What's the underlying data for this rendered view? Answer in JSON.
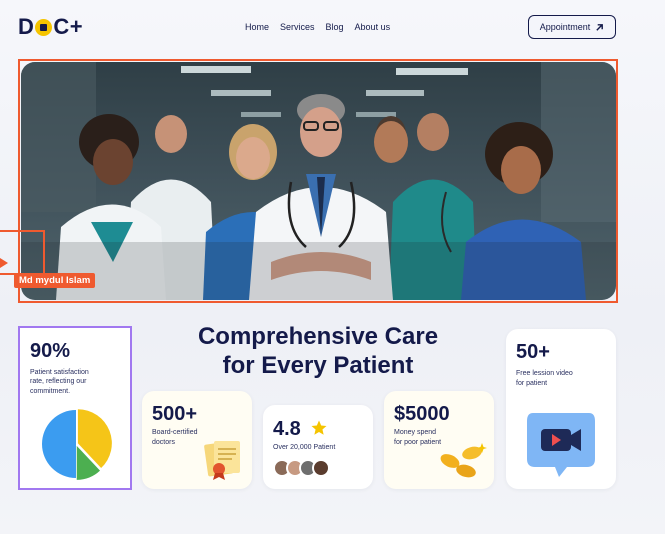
{
  "brand": {
    "logo_pre": "D",
    "logo_post": "C+"
  },
  "nav": {
    "items": [
      "Home",
      "Services",
      "Blog",
      "About us"
    ]
  },
  "header": {
    "appointment_label": "Appointment",
    "appointment_icon": "arrow-up-right-icon"
  },
  "hero": {
    "photo": "doctors-team-photo"
  },
  "annotation": {
    "name_tag": "Md mydul Islam"
  },
  "section": {
    "heading_line1": "Comprehensive Care",
    "heading_line2": "for Every Patient"
  },
  "stats": {
    "satisfaction": {
      "value": "90%",
      "caption": "Patient satisfaction rate, reflecting our commitment.",
      "pie_fractions": [
        0.38,
        0.12,
        0.5
      ],
      "pie_colors": [
        "#f5c518",
        "#4caf50",
        "#3b9cf0"
      ]
    },
    "doctors": {
      "value": "500+",
      "caption_l1": "Board-certified",
      "caption_l2": "doctors"
    },
    "rating": {
      "value": "4.8",
      "caption": "Over 20,000 Patient"
    },
    "money": {
      "value": "$5000",
      "caption_l1": "Money spend",
      "caption_l2": "for poor patient"
    },
    "videos": {
      "value": "50+",
      "caption_l1": "Free lession video",
      "caption_l2": "for patient"
    }
  },
  "colors": {
    "navy": "#141a4a",
    "accent_orange": "#ef5a2f",
    "selection_purple": "#a178f0",
    "star": "#f5c400"
  }
}
